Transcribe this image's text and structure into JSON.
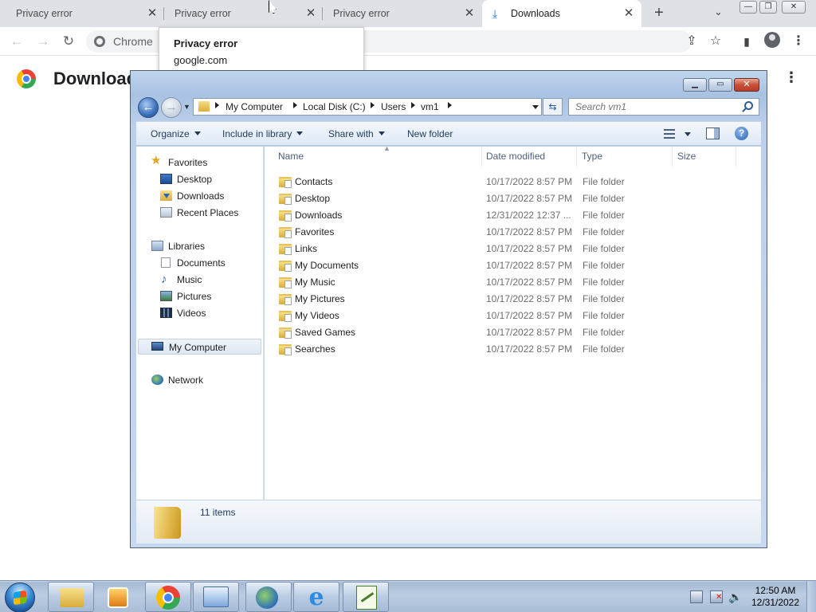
{
  "browser": {
    "tabs": [
      {
        "title": "Privacy error",
        "active": false
      },
      {
        "title": "Privacy error",
        "active": false
      },
      {
        "title": "Privacy error",
        "active": false
      },
      {
        "title": "Downloads",
        "active": true
      }
    ],
    "omnibox_chip": "Chrome",
    "tooltip": {
      "title": "Privacy error",
      "url": "google.com"
    },
    "page_title": "Downloads"
  },
  "explorer": {
    "breadcrumbs": [
      "My Computer",
      "Local Disk (C:)",
      "Users",
      "vm1"
    ],
    "search_placeholder": "Search vm1",
    "commands": {
      "organize": "Organize",
      "include_in_library": "Include in library",
      "share_with": "Share with",
      "new_folder": "New folder"
    },
    "columns": {
      "name": "Name",
      "date": "Date modified",
      "type": "Type",
      "size": "Size"
    },
    "nav": {
      "favorites": "Favorites",
      "desktop": "Desktop",
      "downloads": "Downloads",
      "recent_places": "Recent Places",
      "libraries": "Libraries",
      "documents": "Documents",
      "music": "Music",
      "pictures": "Pictures",
      "videos": "Videos",
      "my_computer": "My Computer",
      "network": "Network"
    },
    "files": [
      {
        "name": "Contacts",
        "date": "10/17/2022 8:57 PM",
        "type": "File folder"
      },
      {
        "name": "Desktop",
        "date": "10/17/2022 8:57 PM",
        "type": "File folder"
      },
      {
        "name": "Downloads",
        "date": "12/31/2022 12:37 ...",
        "type": "File folder"
      },
      {
        "name": "Favorites",
        "date": "10/17/2022 8:57 PM",
        "type": "File folder"
      },
      {
        "name": "Links",
        "date": "10/17/2022 8:57 PM",
        "type": "File folder"
      },
      {
        "name": "My Documents",
        "date": "10/17/2022 8:57 PM",
        "type": "File folder"
      },
      {
        "name": "My Music",
        "date": "10/17/2022 8:57 PM",
        "type": "File folder"
      },
      {
        "name": "My Pictures",
        "date": "10/17/2022 8:57 PM",
        "type": "File folder"
      },
      {
        "name": "My Videos",
        "date": "10/17/2022 8:57 PM",
        "type": "File folder"
      },
      {
        "name": "Saved Games",
        "date": "10/17/2022 8:57 PM",
        "type": "File folder"
      },
      {
        "name": "Searches",
        "date": "10/17/2022 8:57 PM",
        "type": "File folder"
      }
    ],
    "item_count": "11 items"
  },
  "taskbar": {
    "time": "12:50 AM",
    "date": "12/31/2022"
  },
  "colors": {
    "chrome_tabstrip": "#dee1e6",
    "explorer_frame": "#a8c2e2",
    "close_red": "#c8503a",
    "folder_yellow": "#e0b548"
  }
}
